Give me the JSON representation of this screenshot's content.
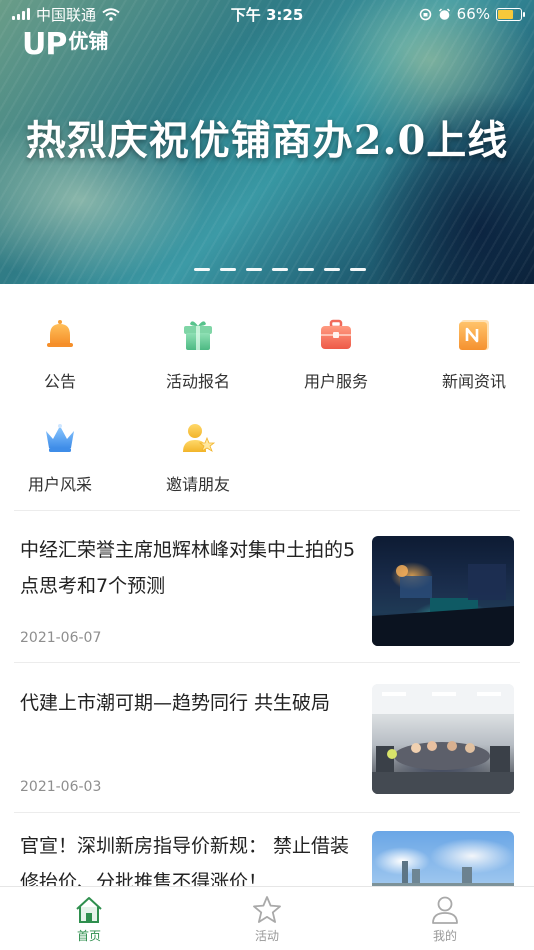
{
  "status_bar": {
    "carrier": "中国联通",
    "time": "下午 3:25",
    "battery": "66%",
    "battery_level": 0.66
  },
  "banner": {
    "logo_text": "UP",
    "logo_cn": "优铺",
    "title": "热烈庆祝优铺商办2.0上线",
    "slide_count": 7
  },
  "quick_menu": [
    {
      "label": "公告",
      "icon": "bell-icon",
      "color": "#f5a03a"
    },
    {
      "label": "活动报名",
      "icon": "gift-icon",
      "color": "#58c38c"
    },
    {
      "label": "用户服务",
      "icon": "briefcase-icon",
      "color": "#f06a5a"
    },
    {
      "label": "新闻资讯",
      "icon": "news-icon",
      "color": "#f5a03a"
    },
    {
      "label": "用户风采",
      "icon": "crown-icon",
      "color": "#4f9ff0"
    },
    {
      "label": "邀请朋友",
      "icon": "invite-user-icon",
      "color": "#f5c23a"
    }
  ],
  "news": [
    {
      "title": "中经汇荣誉主席旭辉林峰对集中土拍的5点思考和7个预测",
      "date": "2021-06-07"
    },
    {
      "title": "代建上市潮可期—趋势同行 共生破局",
      "date": "2021-06-03"
    },
    {
      "title": "官宣！深圳新房指导价新规： 禁止借装修抬价、分批推售不得涨价！",
      "date": ""
    }
  ],
  "tabbar": [
    {
      "label": "首页",
      "icon": "home-icon",
      "active": true
    },
    {
      "label": "活动",
      "icon": "star-icon",
      "active": false
    },
    {
      "label": "我的",
      "icon": "user-icon",
      "active": false
    }
  ],
  "colors": {
    "accent": "#2f8f4e",
    "muted": "#999999"
  }
}
